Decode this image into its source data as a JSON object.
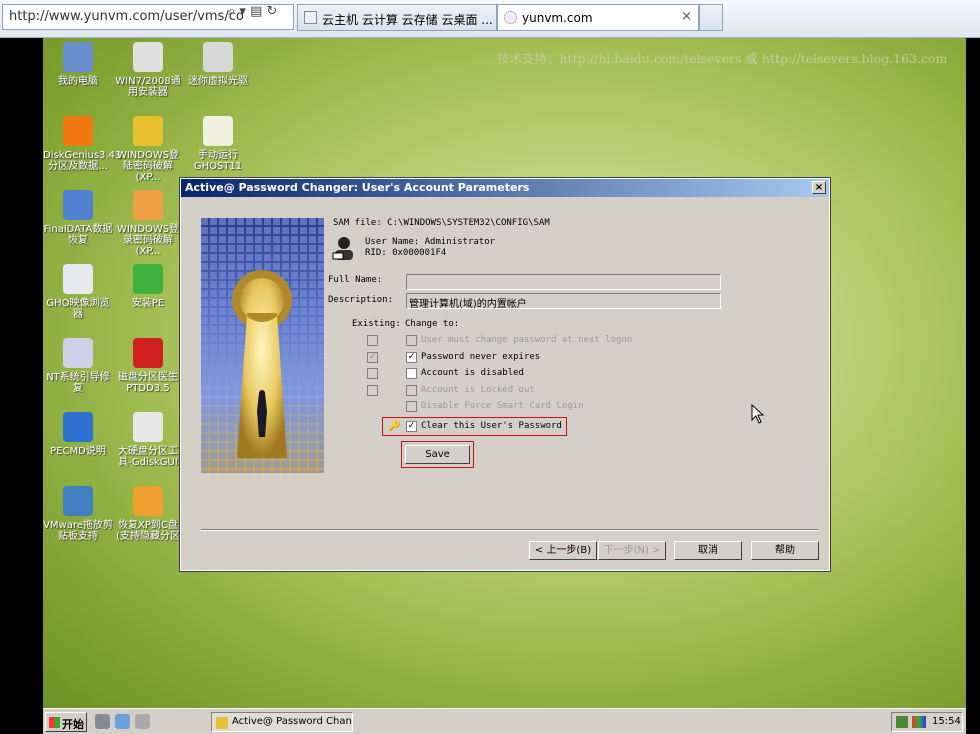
{
  "browser": {
    "address": "http://www.yunvm.com/user/vms/co",
    "tabs": [
      {
        "label": "云主机 云计算 云存储 云桌面 ..."
      },
      {
        "label": "yunvm.com",
        "close": "×"
      }
    ]
  },
  "desktop": {
    "watermark": "技术支持：http://hi.baidu.com/telsevers 或 http://telsevers.blog.163.com",
    "icons": [
      {
        "label": "我的电脑",
        "icon": "computer-icon",
        "color": "#6a8fd0"
      },
      {
        "label": "WIN7/2008通用安装器",
        "icon": "installer-icon",
        "color": "#e0e0e0"
      },
      {
        "label": "迷你虚拟光驱",
        "icon": "virtual-drive-icon",
        "color": "#d8d8d8"
      },
      {
        "label": "DiskGenius3.43分区及数据...",
        "icon": "diskgenius-icon",
        "color": "#f07a10"
      },
      {
        "label": "WINDOWS登陆密码破解(XP...",
        "icon": "key-icon",
        "color": "#e8c030"
      },
      {
        "label": "手动运行GHOST11",
        "icon": "ghost-icon",
        "color": "#f0f0e0"
      },
      {
        "label": "FinalDATA数据恢复",
        "icon": "finaldata-icon",
        "color": "#5080d0"
      },
      {
        "label": "WINDOWS登录密码破解(XP...",
        "icon": "password-icon",
        "color": "#f0a040"
      },
      {
        "label": "GHO映像浏览器",
        "icon": "gho-browser-icon",
        "color": "#e8e8f0"
      },
      {
        "label": "安装PE",
        "icon": "install-pe-icon",
        "color": "#40b040"
      },
      {
        "label": "NT系统引导修复",
        "icon": "nt-boot-icon",
        "color": "#d0d0e8"
      },
      {
        "label": "磁盘分区医生PTDD3.5",
        "icon": "ptdd-icon",
        "color": "#d02020"
      },
      {
        "label": "PECMD说明",
        "icon": "help-icon",
        "color": "#3070d0"
      },
      {
        "label": "大硬盘分区工具-GdiskGUI",
        "icon": "gdisk-icon",
        "color": "#e8e8e8"
      },
      {
        "label": "VMware拖放剪贴板支持",
        "icon": "vmware-icon",
        "color": "#4080c0"
      },
      {
        "label": "恢复XP到C盘(支持隐藏分区",
        "icon": "windows-xp-icon",
        "color": "#f0a030"
      }
    ]
  },
  "dialog": {
    "title": "Active@ Password Changer: User's Account Parameters",
    "close": "×",
    "sam_file": "SAM file: C:\\WINDOWS\\SYSTEM32\\CONFIG\\SAM",
    "user_name": "User Name: Administrator",
    "rid": "RID: 0x000001F4",
    "full_name_label": "Full Name:",
    "full_name_value": "",
    "description_label": "Description:",
    "description_value": "管理计算机(域)的内置帐户",
    "existing_label": "Existing:",
    "change_to_label": "Change to:",
    "options": [
      {
        "label": "User must change password at next logon",
        "existing": false,
        "checked": false,
        "disabled": true,
        "has_existing": true
      },
      {
        "label": "Password never expires",
        "existing": true,
        "checked": true,
        "disabled": false,
        "has_existing": true
      },
      {
        "label": "Account is disabled",
        "existing": false,
        "checked": false,
        "disabled": false,
        "has_existing": true
      },
      {
        "label": "Account is Locked out",
        "existing": false,
        "checked": false,
        "disabled": true,
        "has_existing": true
      },
      {
        "label": "Disable Force Smart Card Login",
        "existing": false,
        "checked": false,
        "disabled": true,
        "has_existing": false
      }
    ],
    "clear_password_label": "Clear this User's Password",
    "clear_password_checked": true,
    "save_label": "Save",
    "buttons": {
      "back": "< 上一步(B)",
      "next": "下一步(N) >",
      "cancel": "取消",
      "help": "帮助"
    }
  },
  "taskbar": {
    "start": "开始",
    "task": "Active@ Password Chan...",
    "clock": "15:54"
  },
  "colors": {
    "title_bar": "#0a246a",
    "highlight_box": "#d01010",
    "desktop_green": "#a3bf55"
  }
}
